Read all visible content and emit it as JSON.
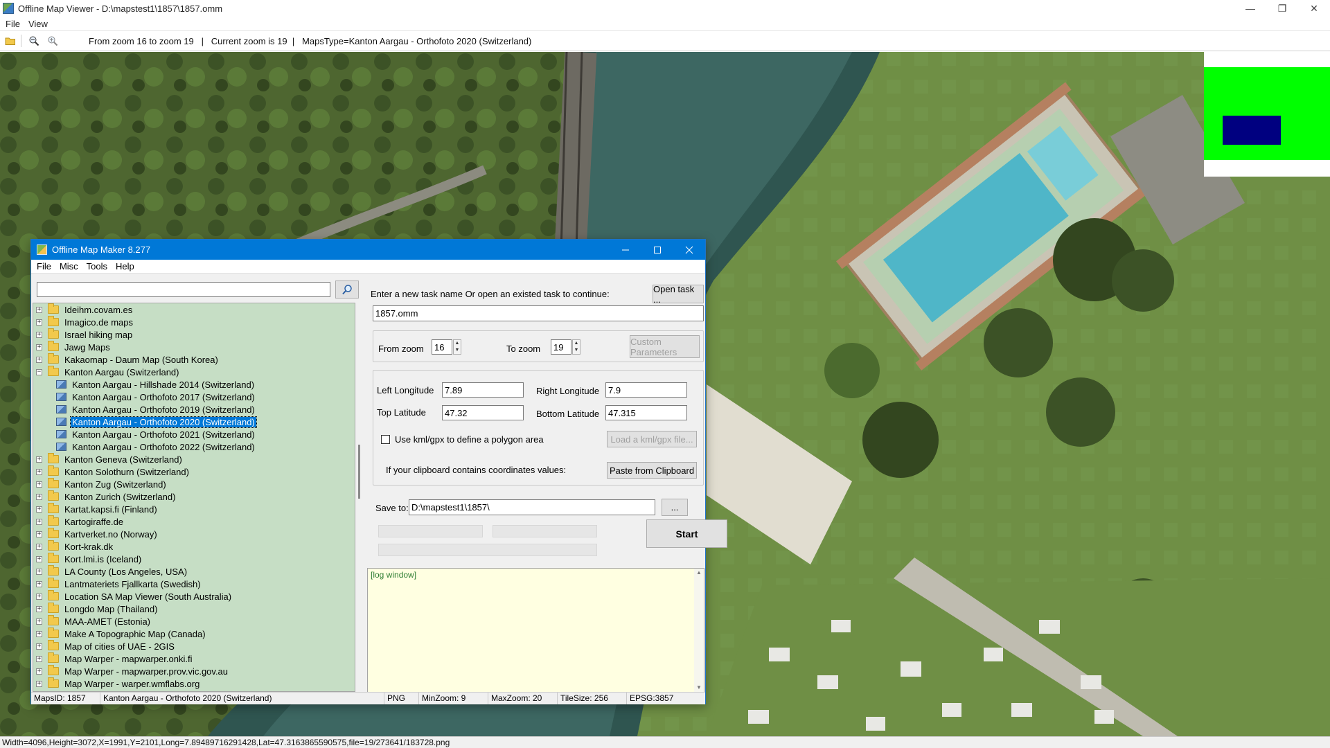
{
  "window": {
    "title": "Offline Map Viewer - D:\\mapstest1\\1857\\1857.omm",
    "controls": [
      "—",
      "❐",
      "✕"
    ]
  },
  "menubar": [
    "File",
    "View"
  ],
  "toolbar": {
    "info": "From zoom 16 to zoom 19   |   Current zoom is 19  |   MapsType=Kanton Aargau - Orthofoto 2020 (Switzerland)"
  },
  "statusbar": {
    "text": "Width=4096,Height=3072,X=1991,Y=2101,Long=7.89489716291428,Lat=47.3163865590575,file=19/273641/183728.png"
  },
  "dialog": {
    "title": "Offline Map Maker 8.277",
    "menu": [
      "File",
      "Misc",
      "Tools",
      "Help"
    ],
    "search": {
      "value": "",
      "placeholder": ""
    },
    "tree": [
      {
        "label": "Ideihm.covam.es",
        "type": "folder",
        "expanded": false
      },
      {
        "label": "Imagico.de maps",
        "type": "folder",
        "expanded": false
      },
      {
        "label": "Israel hiking map",
        "type": "folder",
        "expanded": false
      },
      {
        "label": "Jawg Maps",
        "type": "folder",
        "expanded": false
      },
      {
        "label": "Kakaomap - Daum Map (South Korea)",
        "type": "folder",
        "expanded": false
      },
      {
        "label": "Kanton Aargau (Switzerland)",
        "type": "folder",
        "expanded": true
      },
      {
        "label": "Kanton Aargau - Hillshade 2014 (Switzerland)",
        "type": "map"
      },
      {
        "label": "Kanton Aargau - Orthofoto 2017 (Switzerland)",
        "type": "map"
      },
      {
        "label": "Kanton Aargau - Orthofoto 2019 (Switzerland)",
        "type": "map"
      },
      {
        "label": "Kanton Aargau - Orthofoto 2020 (Switzerland)",
        "type": "map",
        "selected": true
      },
      {
        "label": "Kanton Aargau - Orthofoto 2021 (Switzerland)",
        "type": "map"
      },
      {
        "label": "Kanton Aargau - Orthofoto 2022 (Switzerland)",
        "type": "map"
      },
      {
        "label": "Kanton Geneva (Switzerland)",
        "type": "folder",
        "expanded": false
      },
      {
        "label": "Kanton Solothurn (Switzerland)",
        "type": "folder",
        "expanded": false
      },
      {
        "label": "Kanton Zug (Switzerland)",
        "type": "folder",
        "expanded": false
      },
      {
        "label": "Kanton Zurich (Switzerland)",
        "type": "folder",
        "expanded": false
      },
      {
        "label": "Kartat.kapsi.fi (Finland)",
        "type": "folder",
        "expanded": false
      },
      {
        "label": "Kartogiraffe.de",
        "type": "folder",
        "expanded": false
      },
      {
        "label": "Kartverket.no (Norway)",
        "type": "folder",
        "expanded": false
      },
      {
        "label": "Kort-krak.dk",
        "type": "folder",
        "expanded": false
      },
      {
        "label": "Kort.lmi.is (Iceland)",
        "type": "folder",
        "expanded": false
      },
      {
        "label": "LA County (Los Angeles, USA)",
        "type": "folder",
        "expanded": false
      },
      {
        "label": "Lantmateriets Fjallkarta (Swedish)",
        "type": "folder",
        "expanded": false
      },
      {
        "label": "Location SA Map Viewer (South Australia)",
        "type": "folder",
        "expanded": false
      },
      {
        "label": "Longdo Map (Thailand)",
        "type": "folder",
        "expanded": false
      },
      {
        "label": "MAA-AMET (Estonia)",
        "type": "folder",
        "expanded": false
      },
      {
        "label": "Make A Topographic Map (Canada)",
        "type": "folder",
        "expanded": false
      },
      {
        "label": "Map of cities of UAE - 2GIS",
        "type": "folder",
        "expanded": false
      },
      {
        "label": "Map Warper - mapwarper.onki.fi",
        "type": "folder",
        "expanded": false
      },
      {
        "label": "Map Warper - mapwarper.prov.vic.gov.au",
        "type": "folder",
        "expanded": false
      },
      {
        "label": "Map Warper - warper.wmflabs.org",
        "type": "folder",
        "expanded": false
      }
    ],
    "task": {
      "prompt": "Enter a new task name Or open an existed task to continue:",
      "open_label": "Open task ...",
      "name": "1857.omm"
    },
    "zoom": {
      "from_label": "From zoom",
      "from_value": "16",
      "to_label": "To zoom",
      "to_value": "19",
      "custom_label": "Custom Parameters"
    },
    "coords": {
      "left_label": "Left Longitude",
      "left_value": "7.89",
      "right_label": "Right Longitude",
      "right_value": "7.9",
      "top_label": "Top Latitude",
      "top_value": "47.32",
      "bottom_label": "Bottom Latitude",
      "bottom_value": "47.315",
      "kml_label": "Use kml/gpx to define a polygon area",
      "kml_button": "Load a kml/gpx file...",
      "clipboard_label": "If your clipboard contains coordinates values:",
      "clipboard_button": "Paste from Clipboard"
    },
    "save": {
      "label": "Save to:",
      "path": "D:\\mapstest1\\1857\\",
      "browse_label": "...",
      "start_label": "Start"
    },
    "log": {
      "text": "[log window]"
    },
    "status": {
      "maps_id": "MapsID: 1857",
      "maps_name": "Kanton Aargau - Orthofoto 2020 (Switzerland)",
      "format": "PNG",
      "min_zoom": "MinZoom: 9",
      "max_zoom": "MaxZoom: 20",
      "tile_size": "TileSize: 256",
      "epsg": "EPSG:3857"
    }
  }
}
